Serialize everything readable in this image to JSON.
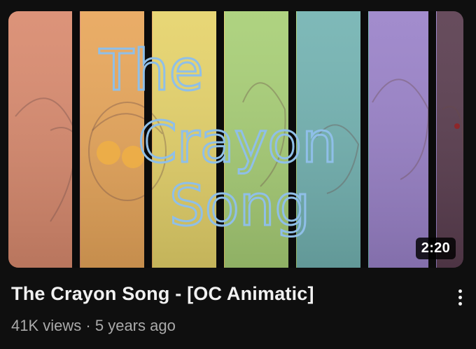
{
  "thumbnail": {
    "title_lines": [
      "The",
      "Crayon",
      "Song"
    ],
    "stripe_colors": [
      "#d98a6e",
      "#e8a65a",
      "#e6d36a",
      "#a8cf76",
      "#73b3b2",
      "#9a82c9",
      "#5a3d4f"
    ],
    "title_color": "#8fbfe8"
  },
  "video": {
    "duration": "2:20",
    "title": "The Crayon Song - [OC Animatic]",
    "views": "41K views",
    "separator": "·",
    "age": "5 years ago"
  },
  "menu": {
    "icon": "more-vertical-icon"
  }
}
